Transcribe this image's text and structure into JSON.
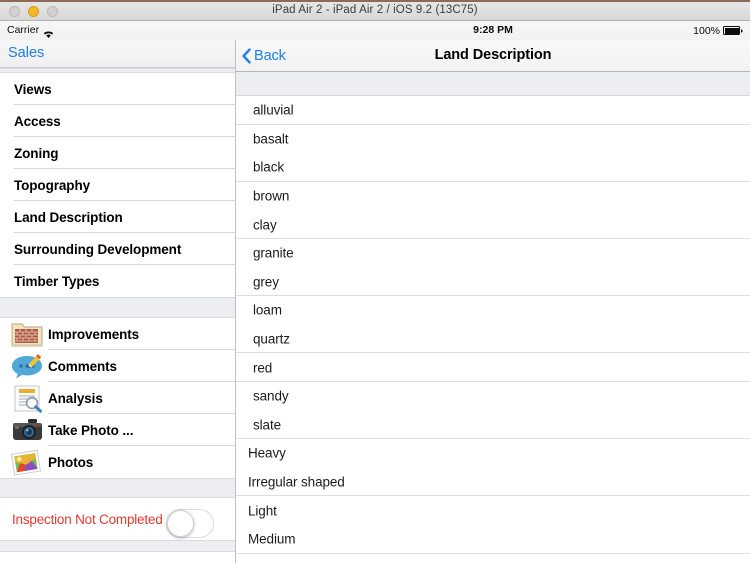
{
  "window": {
    "title": "iPad Air 2 - iPad Air 2 / iOS 9.2 (13C75)",
    "controls": [
      {
        "name": "close",
        "color": "#d3d0cd",
        "state": "disabled"
      },
      {
        "name": "minimize",
        "color": "#f5b829",
        "state": "enabled"
      },
      {
        "name": "zoom",
        "color": "#d3d0cd",
        "state": "disabled"
      }
    ]
  },
  "status_bar": {
    "carrier": "Carrier",
    "wifi_icon": "wifi-icon",
    "time": "9:28 PM",
    "battery_percent": "100%",
    "battery_icon": "battery-full-icon"
  },
  "sidebar": {
    "header_title": "Sales",
    "sections": [
      {
        "items": [
          {
            "label": "Views"
          },
          {
            "label": "Access"
          },
          {
            "label": "Zoning"
          },
          {
            "label": "Topography"
          },
          {
            "label": "Land Description"
          },
          {
            "label": "Surrounding Development"
          },
          {
            "label": "Timber Types"
          }
        ]
      },
      {
        "items": [
          {
            "label": "Improvements",
            "icon": "folder-bricks-icon"
          },
          {
            "label": "Comments",
            "icon": "speech-bubble-pencil-icon"
          },
          {
            "label": "Analysis",
            "icon": "document-magnifier-icon"
          },
          {
            "label": "Take Photo ...",
            "icon": "camera-icon"
          },
          {
            "label": "Photos",
            "icon": "photo-stack-icon"
          }
        ]
      }
    ],
    "inspection": {
      "label": "Inspection Not Completed",
      "label_color": "#e8382f",
      "toggle_state": "off"
    }
  },
  "detail": {
    "back_label": "Back",
    "back_icon": "chevron-left-icon",
    "title": "Land Description",
    "accent_color": "#1b7fe8",
    "options": [
      {
        "label": "alluvial",
        "indent": "ind"
      },
      {
        "label": "basalt",
        "indent": "ind"
      },
      {
        "label": "black",
        "indent": "ind"
      },
      {
        "label": "brown",
        "indent": "ind"
      },
      {
        "label": "clay",
        "indent": "ind"
      },
      {
        "label": "granite",
        "indent": "ind"
      },
      {
        "label": "grey",
        "indent": "ind"
      },
      {
        "label": "loam",
        "indent": "ind"
      },
      {
        "label": "quartz",
        "indent": "ind"
      },
      {
        "label": "red",
        "indent": "ind"
      },
      {
        "label": "sandy",
        "indent": "ind"
      },
      {
        "label": "slate",
        "indent": "ind"
      },
      {
        "label": "Heavy",
        "indent": "flush"
      },
      {
        "label": "Irregular shaped",
        "indent": "flush"
      },
      {
        "label": "Light",
        "indent": "flush"
      },
      {
        "label": "Medium",
        "indent": "flush"
      }
    ]
  }
}
